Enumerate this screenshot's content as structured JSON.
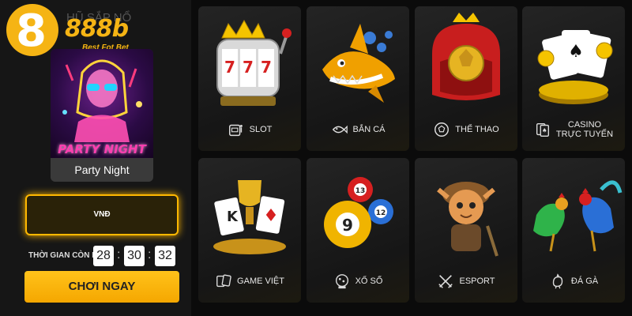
{
  "brand": {
    "logo_mark": "8",
    "logo_text": "888b",
    "slogan": "Best Fot Bet"
  },
  "jackpot": {
    "heading": "HŨ SẮP NỔ",
    "featured_game": {
      "art_title": "PARTY NIGHT",
      "name": "Party Night"
    },
    "currency": "VNĐ",
    "countdown_label": "THỜI GIAN CÒN LẠI:",
    "countdown": {
      "hours": "28",
      "minutes": "30",
      "seconds": "32",
      "separator": ":"
    },
    "play_label": "CHƠI NGAY"
  },
  "categories": [
    {
      "label": "SLOT",
      "icon": "slot-machine-icon"
    },
    {
      "label": "BẮN CÁ",
      "icon": "fish-icon"
    },
    {
      "label": "THỂ THAO",
      "icon": "soccer-ball-icon"
    },
    {
      "label": "CASINO TRỰC TUYẾN",
      "label_line1": "CASINO",
      "label_line2": "TRỰC TUYẾN",
      "icon": "playing-cards-icon"
    },
    {
      "label": "GAME VIỆT",
      "icon": "card-game-icon"
    },
    {
      "label": "XỔ SỐ",
      "icon": "lottery-ball-icon"
    },
    {
      "label": "ESPORT",
      "icon": "crossed-swords-icon"
    },
    {
      "label": "ĐÁ GÀ",
      "icon": "rooster-icon"
    }
  ],
  "colors": {
    "accent": "#f5b414",
    "button": "#ffb800",
    "background": "#0b0b0b",
    "tile": "#1c1c1c"
  }
}
